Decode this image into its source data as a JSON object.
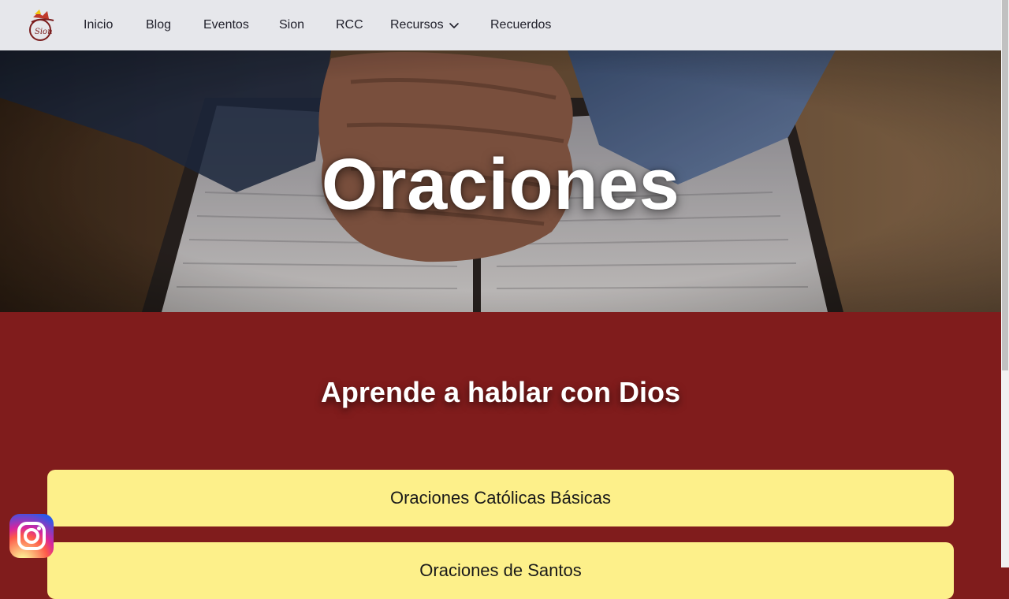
{
  "nav": {
    "items": [
      {
        "label": "Inicio"
      },
      {
        "label": "Blog"
      },
      {
        "label": "Eventos"
      },
      {
        "label": "Sion"
      },
      {
        "label": "RCC"
      },
      {
        "label": "Recursos"
      },
      {
        "label": "Recuerdos"
      }
    ]
  },
  "hero": {
    "title": "Oraciones"
  },
  "main": {
    "section_title": "Aprende a hablar con Dios",
    "cards": [
      {
        "label": "Oraciones Católicas Básicas"
      },
      {
        "label": "Oraciones de Santos"
      }
    ]
  },
  "colors": {
    "navbar_bg": "#e6e7eb",
    "main_bg": "#801c1c",
    "card_bg": "#fdf08a"
  },
  "icons": {
    "logo": "sion-logo",
    "dropdown": "chevron-down-icon",
    "social": "instagram-icon"
  }
}
